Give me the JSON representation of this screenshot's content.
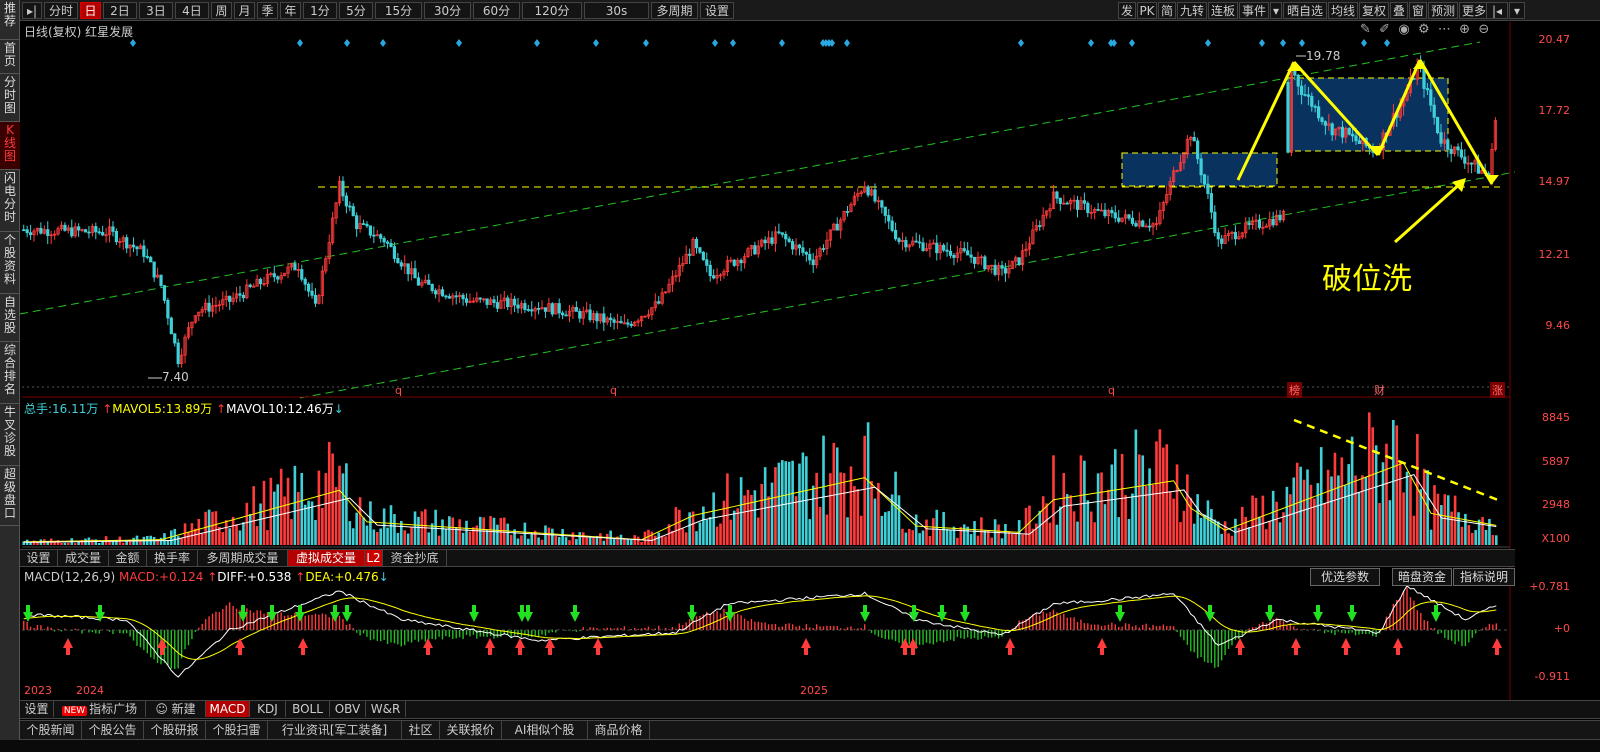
{
  "sidebar": {
    "items": [
      {
        "label": "推荐",
        "height": 40
      },
      {
        "label": "首页",
        "height": 34
      },
      {
        "label": "分时图",
        "height": 48
      },
      {
        "label": "K线图",
        "height": 48,
        "active": true
      },
      {
        "label": "闪电分时",
        "height": 62
      },
      {
        "label": "个股资料",
        "height": 62
      },
      {
        "label": "自选股",
        "height": 48
      },
      {
        "label": "综合排名",
        "height": 62
      },
      {
        "label": "牛叉诊股",
        "height": 62
      },
      {
        "label": "超级盘口",
        "height": 60
      }
    ]
  },
  "topbar": {
    "left": [
      "分时",
      "日",
      "2日",
      "3日",
      "4日",
      "周",
      "月",
      "季",
      "年",
      "1分",
      "5分",
      "15分",
      "30分",
      "60分",
      "120分",
      "30s",
      "多周期",
      "设置"
    ],
    "active": "日",
    "right": [
      "发",
      "PK",
      "简",
      "九转",
      "连板",
      "事件",
      "",
      "晒自选",
      "均线",
      "复权",
      "叠",
      "窗",
      "预测",
      "更多"
    ]
  },
  "header": {
    "title": "日线(复权)  红星发展"
  },
  "price_axis": [
    "20.47",
    "17.72",
    "14.97",
    "12.21",
    "9.46"
  ],
  "annotations": {
    "high": "19.78",
    "low": "7.40",
    "text": "破位洗"
  },
  "markers": {
    "q": "q",
    "bang": "榜",
    "cai": "财",
    "zhang": "涨"
  },
  "volume": {
    "legend_total_label": "总手:",
    "legend_total": "16.11万",
    "legend_ma5_label": "MAVOL5:",
    "legend_ma5": "13.89万",
    "legend_ma10_label": "MAVOL10:",
    "legend_ma10": "12.46万",
    "axis": [
      "8845",
      "5897",
      "2948",
      "X100"
    ]
  },
  "vol_tabs": [
    "设置",
    "成交量",
    "金额",
    "换手率",
    "多周期成交量",
    "虚拟成交量",
    "资金抄底"
  ],
  "vol_tab_active": "虚拟成交量",
  "vol_badge": "L2",
  "macd": {
    "legend_name": "MACD(12,26,9)",
    "legend_macd_label": "MACD:",
    "legend_macd": "+0.124",
    "legend_diff_label": "DIFF:",
    "legend_diff": "+0.538",
    "legend_dea_label": "DEA:",
    "legend_dea": "+0.476",
    "buttons": [
      "优选参数",
      "暗盘资金",
      "指标说明"
    ],
    "axis": [
      "+0.781",
      "+0",
      "-0.911"
    ]
  },
  "time_axis": [
    "2023",
    "2024",
    "2025"
  ],
  "indicator_tabs": {
    "setup": "设置",
    "new_badge": "NEW",
    "market": "指标广场",
    "create": "新建",
    "items": [
      "MACD",
      "KDJ",
      "BOLL",
      "OBV",
      "W&R"
    ],
    "active": "MACD"
  },
  "bottom_tabs": [
    "个股新闻",
    "个股公告",
    "个股研报",
    "个股扫雷",
    "行业资讯[军工装备]",
    "社区",
    "关联报价",
    "AI相似个股",
    "商品价格"
  ],
  "colors": {
    "up": "#ff3b3b",
    "down": "#3fd0d8",
    "accent_yellow": "#ffff00",
    "channel": "#22c022",
    "box": "#0b3b70"
  }
}
